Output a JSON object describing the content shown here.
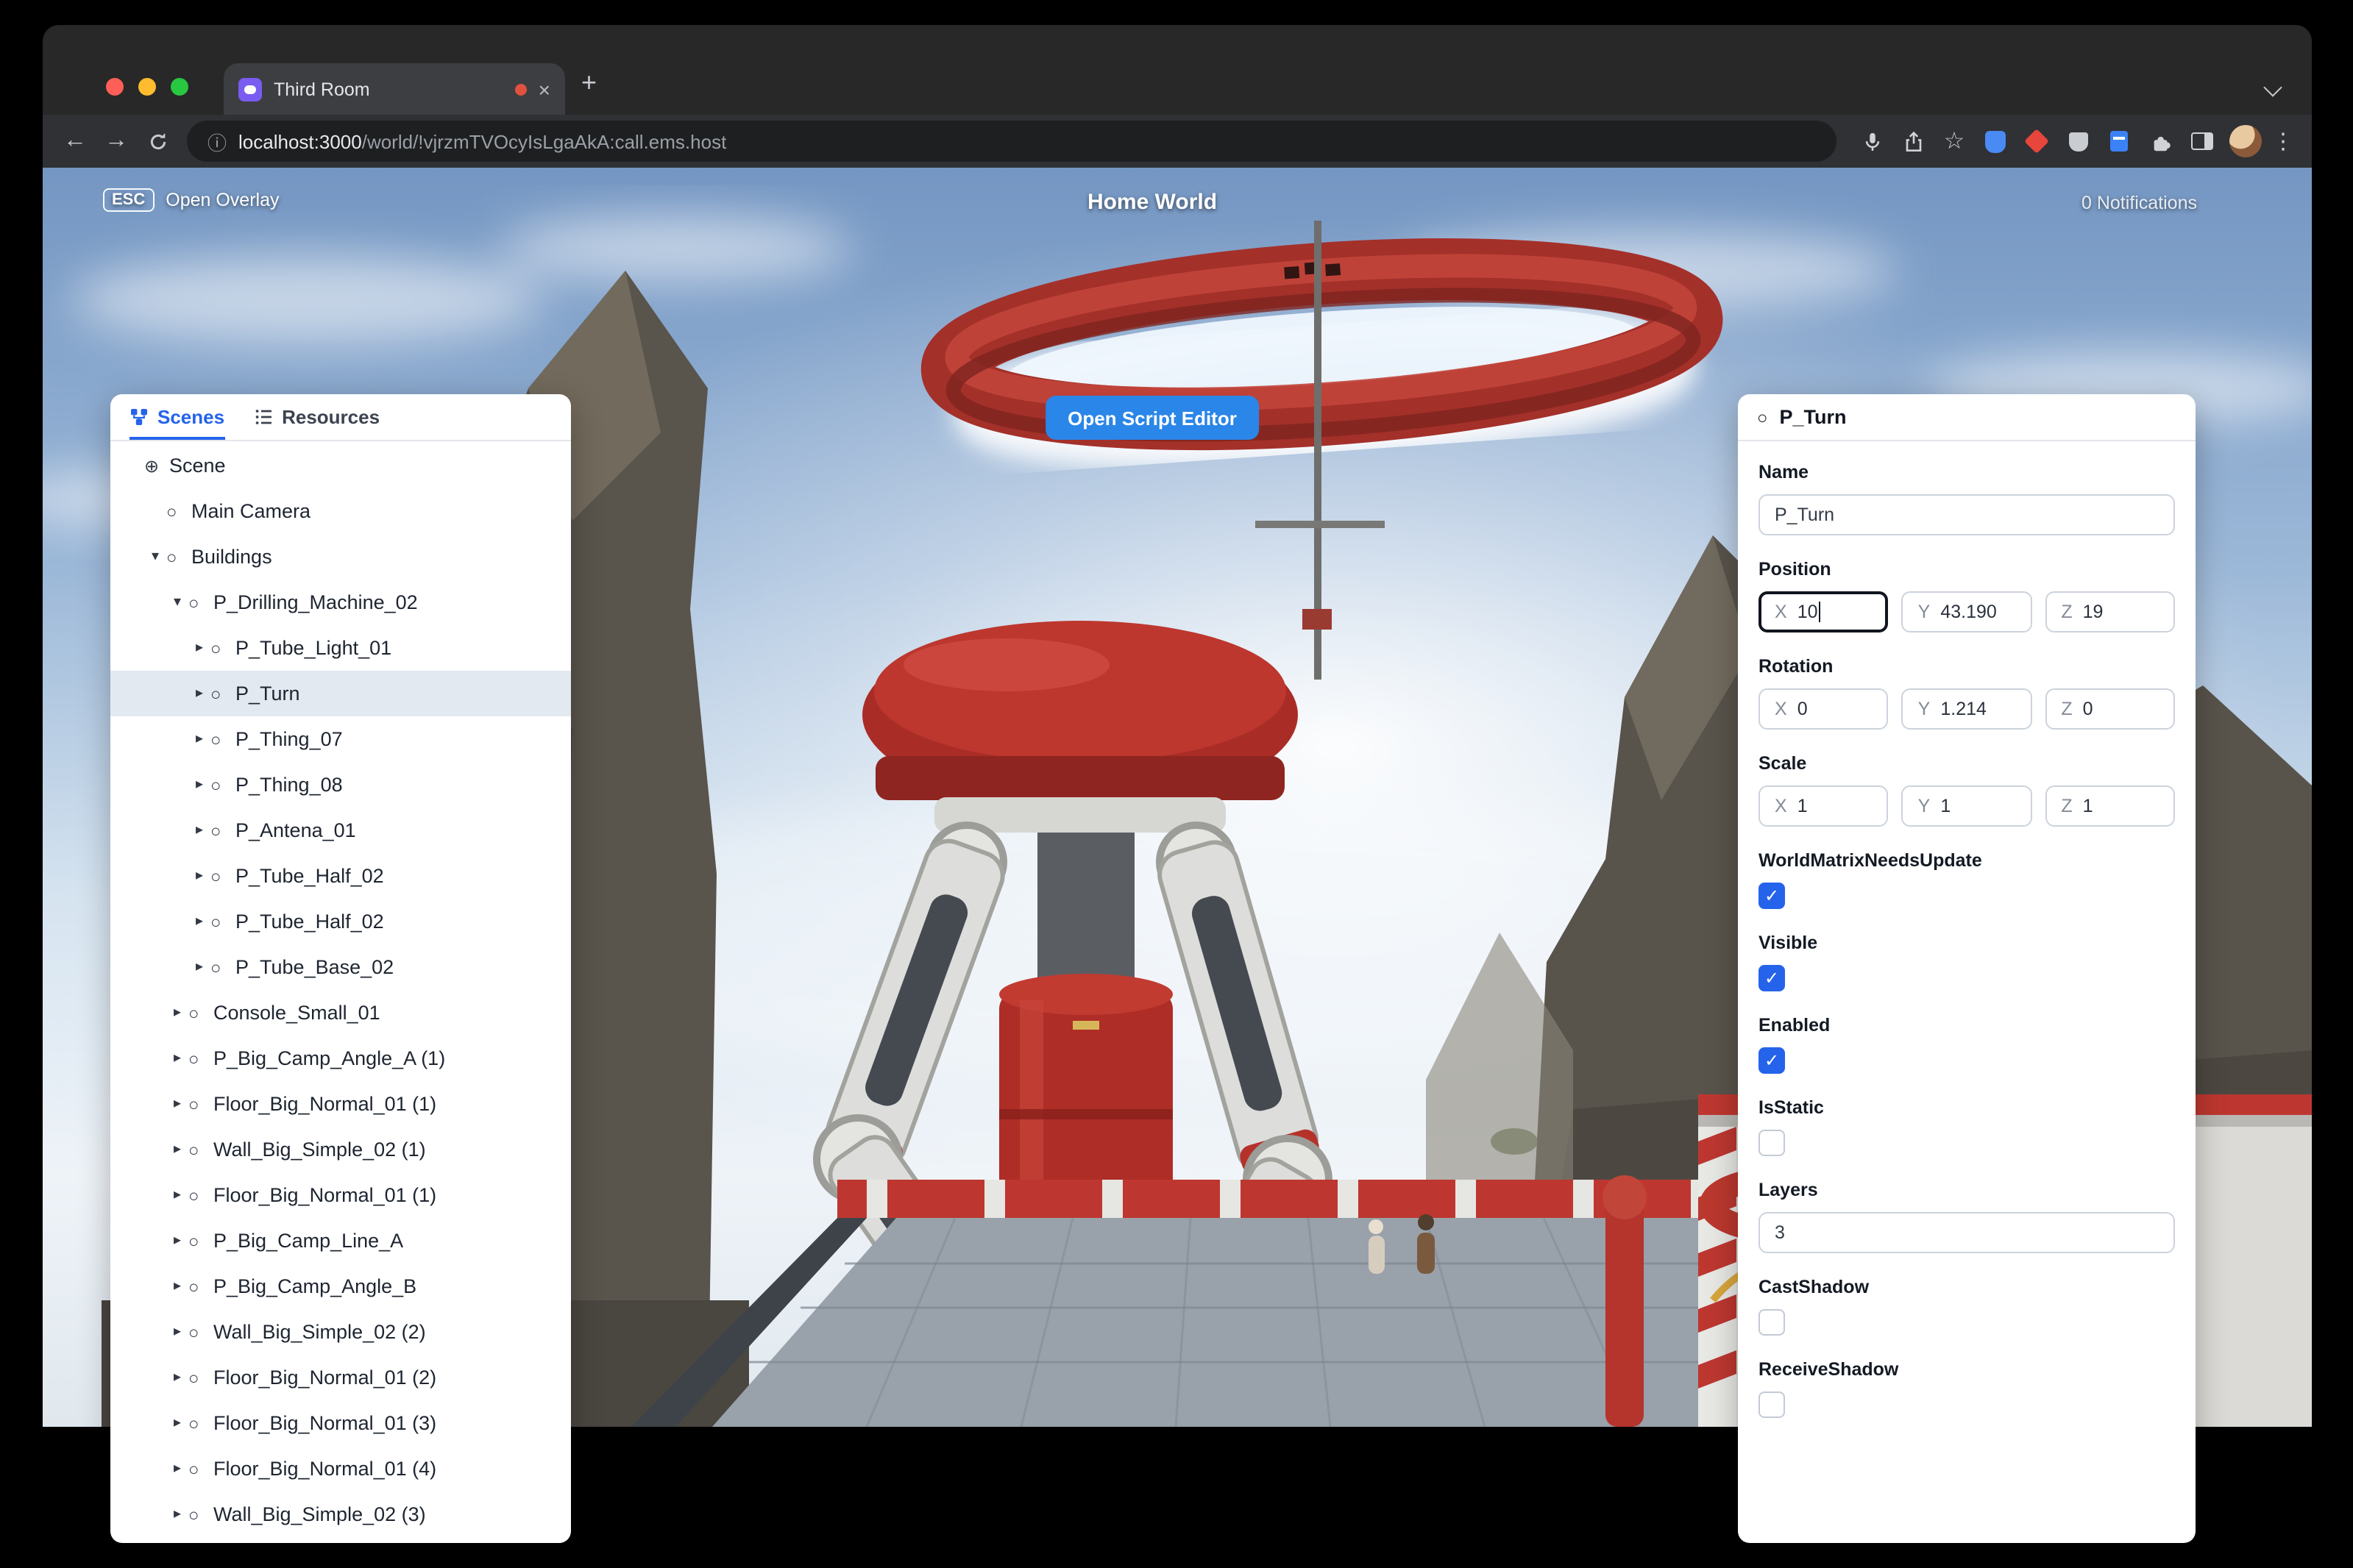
{
  "browser": {
    "tab": {
      "title": "Third Room"
    },
    "url_host": "localhost:3000",
    "url_path": "/world/!vjrzmTVOcyIsLgaAkA:call.ems.host"
  },
  "glyphs": {
    "back": "←",
    "forward": "→",
    "info": "ⓘ",
    "star": "☆",
    "menu": "⋮",
    "close_tab": "×",
    "new_tab": "+",
    "expanded_arrow": "▾",
    "collapsed_arrow": "▸",
    "circle_node": "○",
    "globe": "⊕",
    "check": "✓"
  },
  "hud": {
    "esc_key": "ESC",
    "open_overlay": "Open Overlay",
    "world_title": "Home World",
    "notifications": "0 Notifications",
    "open_script_editor": "Open Script Editor"
  },
  "left_panel": {
    "tabs": [
      {
        "label": "Scenes",
        "active": true
      },
      {
        "label": "Resources",
        "active": false
      }
    ],
    "tree": [
      {
        "label": "Scene",
        "depth": 0,
        "icon": "globe",
        "arrow": "none",
        "selected": false
      },
      {
        "label": "Main Camera",
        "depth": 1,
        "icon": "circle",
        "arrow": "none",
        "selected": false
      },
      {
        "label": "Buildings",
        "depth": 1,
        "icon": "circle",
        "arrow": "expanded",
        "selected": false
      },
      {
        "label": "P_Drilling_Machine_02",
        "depth": 2,
        "icon": "circle",
        "arrow": "expanded",
        "selected": false
      },
      {
        "label": "P_Tube_Light_01",
        "depth": 3,
        "icon": "circle",
        "arrow": "collapsed",
        "selected": false
      },
      {
        "label": "P_Turn",
        "depth": 3,
        "icon": "circle",
        "arrow": "collapsed",
        "selected": true
      },
      {
        "label": "P_Thing_07",
        "depth": 3,
        "icon": "circle",
        "arrow": "collapsed",
        "selected": false
      },
      {
        "label": "P_Thing_08",
        "depth": 3,
        "icon": "circle",
        "arrow": "collapsed",
        "selected": false
      },
      {
        "label": "P_Antena_01",
        "depth": 3,
        "icon": "circle",
        "arrow": "collapsed",
        "selected": false
      },
      {
        "label": "P_Tube_Half_02",
        "depth": 3,
        "icon": "circle",
        "arrow": "collapsed",
        "selected": false
      },
      {
        "label": "P_Tube_Half_02",
        "depth": 3,
        "icon": "circle",
        "arrow": "collapsed",
        "selected": false
      },
      {
        "label": "P_Tube_Base_02",
        "depth": 3,
        "icon": "circle",
        "arrow": "collapsed",
        "selected": false
      },
      {
        "label": "Console_Small_01",
        "depth": 2,
        "icon": "circle",
        "arrow": "collapsed",
        "selected": false
      },
      {
        "label": "P_Big_Camp_Angle_A (1)",
        "depth": 2,
        "icon": "circle",
        "arrow": "collapsed",
        "selected": false
      },
      {
        "label": "Floor_Big_Normal_01 (1)",
        "depth": 2,
        "icon": "circle",
        "arrow": "collapsed",
        "selected": false
      },
      {
        "label": "Wall_Big_Simple_02 (1)",
        "depth": 2,
        "icon": "circle",
        "arrow": "collapsed",
        "selected": false
      },
      {
        "label": "Floor_Big_Normal_01 (1)",
        "depth": 2,
        "icon": "circle",
        "arrow": "collapsed",
        "selected": false
      },
      {
        "label": "P_Big_Camp_Line_A",
        "depth": 2,
        "icon": "circle",
        "arrow": "collapsed",
        "selected": false
      },
      {
        "label": "P_Big_Camp_Angle_B",
        "depth": 2,
        "icon": "circle",
        "arrow": "collapsed",
        "selected": false
      },
      {
        "label": "Wall_Big_Simple_02 (2)",
        "depth": 2,
        "icon": "circle",
        "arrow": "collapsed",
        "selected": false
      },
      {
        "label": "Floor_Big_Normal_01 (2)",
        "depth": 2,
        "icon": "circle",
        "arrow": "collapsed",
        "selected": false
      },
      {
        "label": "Floor_Big_Normal_01 (3)",
        "depth": 2,
        "icon": "circle",
        "arrow": "collapsed",
        "selected": false
      },
      {
        "label": "Floor_Big_Normal_01 (4)",
        "depth": 2,
        "icon": "circle",
        "arrow": "collapsed",
        "selected": false
      },
      {
        "label": "Wall_Big_Simple_02 (3)",
        "depth": 2,
        "icon": "circle",
        "arrow": "collapsed",
        "selected": false
      }
    ]
  },
  "inspector": {
    "title": "P_Turn",
    "axes": [
      "X",
      "Y",
      "Z"
    ],
    "name": {
      "label": "Name",
      "value": "P_Turn"
    },
    "position": {
      "label": "Position",
      "x": "10",
      "y": "43.190",
      "z": "19"
    },
    "rotation": {
      "label": "Rotation",
      "x": "0",
      "y": "1.214",
      "z": "0"
    },
    "scale": {
      "label": "Scale",
      "x": "1",
      "y": "1",
      "z": "1"
    },
    "fields": [
      {
        "type": "bool",
        "label": "WorldMatrixNeedsUpdate",
        "checked": true
      },
      {
        "type": "bool",
        "label": "Visible",
        "checked": true
      },
      {
        "type": "bool",
        "label": "Enabled",
        "checked": true
      },
      {
        "type": "bool",
        "label": "IsStatic",
        "checked": false
      },
      {
        "type": "text",
        "label": "Layers",
        "value": "3"
      },
      {
        "type": "bool",
        "label": "CastShadow",
        "checked": false
      },
      {
        "type": "bool",
        "label": "ReceiveShadow",
        "checked": false
      }
    ]
  },
  "colors": {
    "accent_blue": "#2a86e8",
    "checkbox_blue": "#2563eb",
    "active_tab_blue": "#2563eb",
    "tree_selection_bg": "#e3e9f1",
    "machine_red": "#b23029"
  }
}
